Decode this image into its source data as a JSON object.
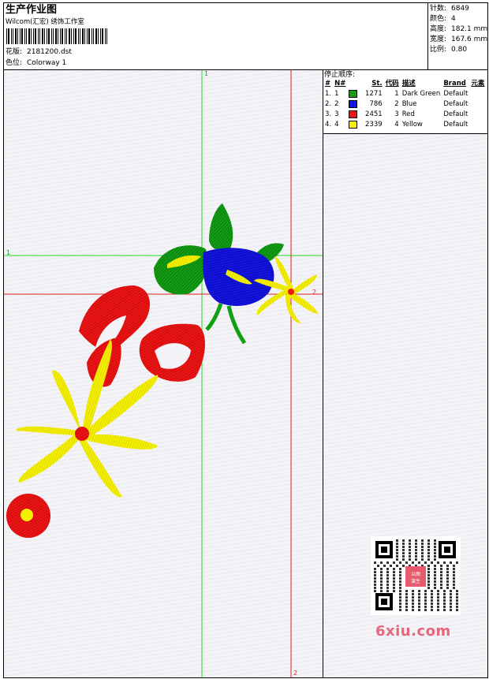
{
  "header": {
    "title": "生产作业图",
    "studio": "Wilcom(汇宏) 绣饰工作室",
    "design_label": "花版:",
    "design_value": "2181200.dst",
    "colorway_label": "色位:",
    "colorway_value": "Colorway 1"
  },
  "stats": {
    "stitches_label": "针数:",
    "stitches_value": "6849",
    "colors_label": "颜色:",
    "colors_value": "4",
    "height_label": "高度:",
    "height_value": "182.1 mm",
    "width_label": "宽度:",
    "width_value": "167.6 mm",
    "scale_label": "比例:",
    "scale_value": "0.80"
  },
  "stop_sequence": {
    "title": "停止顺序:",
    "headers": [
      "#",
      "N#",
      "St.",
      "代码",
      "描述",
      "Brand",
      "元素"
    ],
    "rows": [
      {
        "num": "1.",
        "n": "1",
        "st": "1271",
        "code": "1",
        "desc": "Dark Green",
        "brand": "Default",
        "color": "#11a014"
      },
      {
        "num": "2.",
        "n": "2",
        "st": "786",
        "code": "2",
        "desc": "Blue",
        "brand": "Default",
        "color": "#1414e6"
      },
      {
        "num": "3.",
        "n": "3",
        "st": "2451",
        "code": "3",
        "desc": "Red",
        "brand": "Default",
        "color": "#f01414"
      },
      {
        "num": "4.",
        "n": "4",
        "st": "2339",
        "code": "4",
        "desc": "Yellow",
        "brand": "Default",
        "color": "#f5f000"
      }
    ]
  },
  "guides": {
    "green_top": "1",
    "green_left": "1",
    "red_right": "2",
    "red_bottom": "2"
  },
  "watermark": {
    "site": "6xiu.com",
    "seal": "以图谋生"
  }
}
